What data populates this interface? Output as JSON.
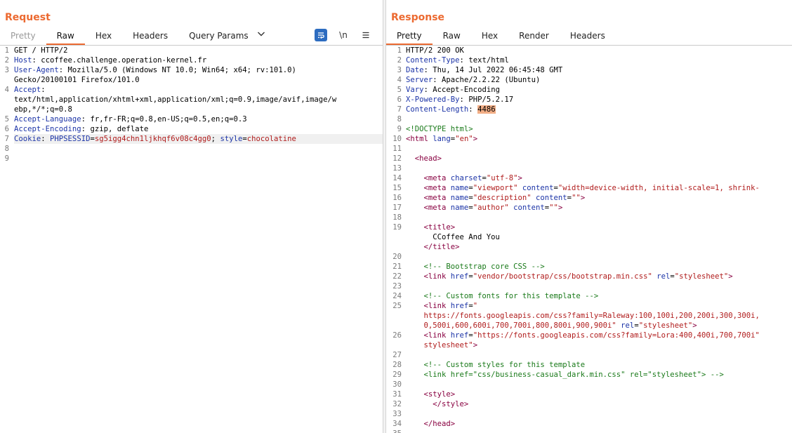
{
  "request": {
    "title": "Request",
    "tabs": [
      "Pretty",
      "Raw",
      "Hex",
      "Headers",
      "Query Params"
    ],
    "active_tab": "Raw",
    "toolbar": {
      "newline_label": "\\n"
    },
    "lines": [
      {
        "n": "1",
        "text": "GET / HTTP/2"
      },
      {
        "n": "2",
        "key": "Host",
        "value": " ccoffee.challenge.operation-kernel.fr"
      },
      {
        "n": "3",
        "key": "User-Agent",
        "value": " Mozilla/5.0 (Windows NT 10.0; Win64; x64; rv:101.0)"
      },
      {
        "n": "",
        "text": "Gecko/20100101 Firefox/101.0"
      },
      {
        "n": "4",
        "key": "Accept",
        "value": ""
      },
      {
        "n": "",
        "text": "text/html,application/xhtml+xml,application/xml;q=0.9,image/avif,image/w"
      },
      {
        "n": "",
        "text": "ebp,*/*;q=0.8"
      },
      {
        "n": "5",
        "key": "Accept-Language",
        "value": " fr,fr-FR;q=0.8,en-US;q=0.5,en;q=0.3"
      },
      {
        "n": "6",
        "key": "Accept-Encoding",
        "value": " gzip, deflate"
      },
      {
        "n": "7",
        "cookie": true
      },
      {
        "n": "8",
        "text": ""
      },
      {
        "n": "9",
        "text": ""
      }
    ],
    "cookie": {
      "key": "Cookie",
      "name1": "PHPSESSID",
      "val1": "sg5igg4chn1ljkhqf6v08c4gg0",
      "name2": "style",
      "val2": "chocolatine"
    }
  },
  "response": {
    "title": "Response",
    "tabs": [
      "Pretty",
      "Raw",
      "Hex",
      "Render",
      "Headers"
    ],
    "active_tab": "Pretty",
    "status_line": "HTTP/2 200 OK",
    "headers": [
      {
        "key": "Content-Type",
        "value": " text/html"
      },
      {
        "key": "Date",
        "value": " Thu, 14 Jul 2022 06:45:48 GMT"
      },
      {
        "key": "Server",
        "value": " Apache/2.2.22 (Ubuntu)"
      },
      {
        "key": "Vary",
        "value": " Accept-Encoding"
      },
      {
        "key": "X-Powered-By",
        "value": " PHP/5.2.17"
      },
      {
        "key": "Content-Length",
        "value": "4486"
      }
    ]
  },
  "colors": {
    "accent": "#ec6a31",
    "header_key": "#1c34a7",
    "value_red": "#b01c1c",
    "comment_green": "#1a7a1a",
    "tag_maroon": "#880040",
    "highlight": "#f2ae86"
  },
  "icons": {
    "wrap": "wrap-lines-icon",
    "menu": "hamburger-menu-icon",
    "dropdown": "chevron-down-icon"
  }
}
